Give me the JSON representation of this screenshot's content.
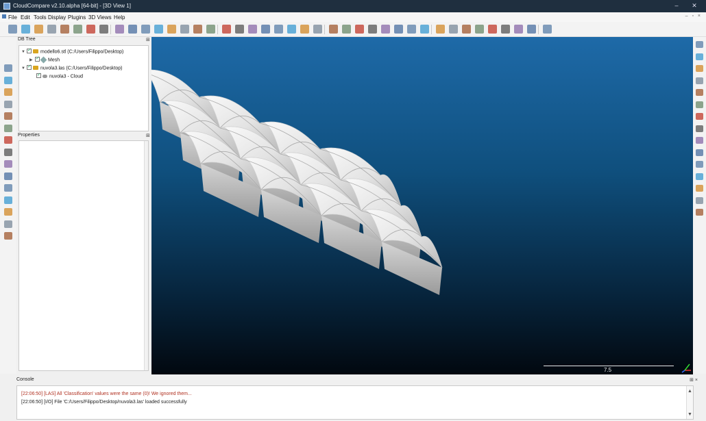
{
  "window": {
    "title": "CloudCompare v2.10.alpha [64-bit] - [3D View 1]",
    "minimize": "–",
    "close": "✕"
  },
  "menu": {
    "items": [
      "File",
      "Edit",
      "Tools",
      "Display",
      "Plugins",
      "3D Views",
      "Help"
    ]
  },
  "db_tree": {
    "title": "DB Tree",
    "items": [
      {
        "label": "modello6.stl (C:/Users/Filippo/Desktop)"
      },
      {
        "label": "Mesh"
      },
      {
        "label": "nuvola3.las (C:/Users/Filippo/Desktop)"
      },
      {
        "label": "nuvola3 - Cloud"
      }
    ]
  },
  "properties": {
    "title": "Properties"
  },
  "view": {
    "scale_value": "7.5",
    "background_top": "#1e6aa8",
    "background_bottom": "#02080f"
  },
  "console": {
    "title": "Console",
    "lines": [
      {
        "text": "[22:06:50] [LAS] All 'Classification' values were the same (0)! We ignored them...",
        "color": "#b03020"
      },
      {
        "text": "[22:06:50] [I/O] File 'C:/Users/Filippo/Desktop/nuvola3.las' loaded successfully",
        "color": "#222222"
      }
    ]
  },
  "icons": {
    "toolbar": [
      "open-icon",
      "save-icon",
      "clone-icon",
      "merge-icon",
      "segment-icon",
      "translate-icon",
      "delete-icon",
      "sample-icon",
      "filter-icon",
      "smooth-icon",
      "normals-icon",
      "orient-icon",
      "octree-icon",
      "sf-icon",
      "color-icon",
      "scalar-icon",
      "distance-icon",
      "align-icon",
      "register-icon",
      "plane-icon",
      "section-icon",
      "measure-icon",
      "point-pick-icon",
      "label-icon",
      "histogram-icon",
      "stats-icon",
      "crop-icon",
      "subsample-icon",
      "mesh-icon",
      "delaunay-icon",
      "cloud-icon",
      "render-icon",
      "light-icon",
      "qanimation-icon",
      "qcompass-icon",
      "qfacets-icon",
      "qhpr-icon",
      "qm3c2-icon",
      "qcanupo-icon",
      "qpcv-icon",
      "qransac-icon"
    ],
    "left": [
      "pin-icon",
      "minus-icon",
      "translate-view-icon",
      "rotate-view-icon",
      "zoom-icon",
      "pick-icon",
      "box-front-icon",
      "box-back-icon",
      "box-left-icon",
      "box-right-icon",
      "box-top-icon",
      "box-bottom-icon",
      "iso1-icon",
      "iso2-icon",
      "color-scale-icon"
    ],
    "right": [
      "settings-icon",
      "grid-icon",
      "table-icon",
      "print-icon",
      "ruler-icon",
      "no-icon",
      "shield-icon",
      "eye-icon",
      "text-icon",
      "ply-icon",
      "models-icon",
      "sphere-icon",
      "triangle-icon",
      "lasso-icon",
      "ellipse-icon"
    ]
  }
}
